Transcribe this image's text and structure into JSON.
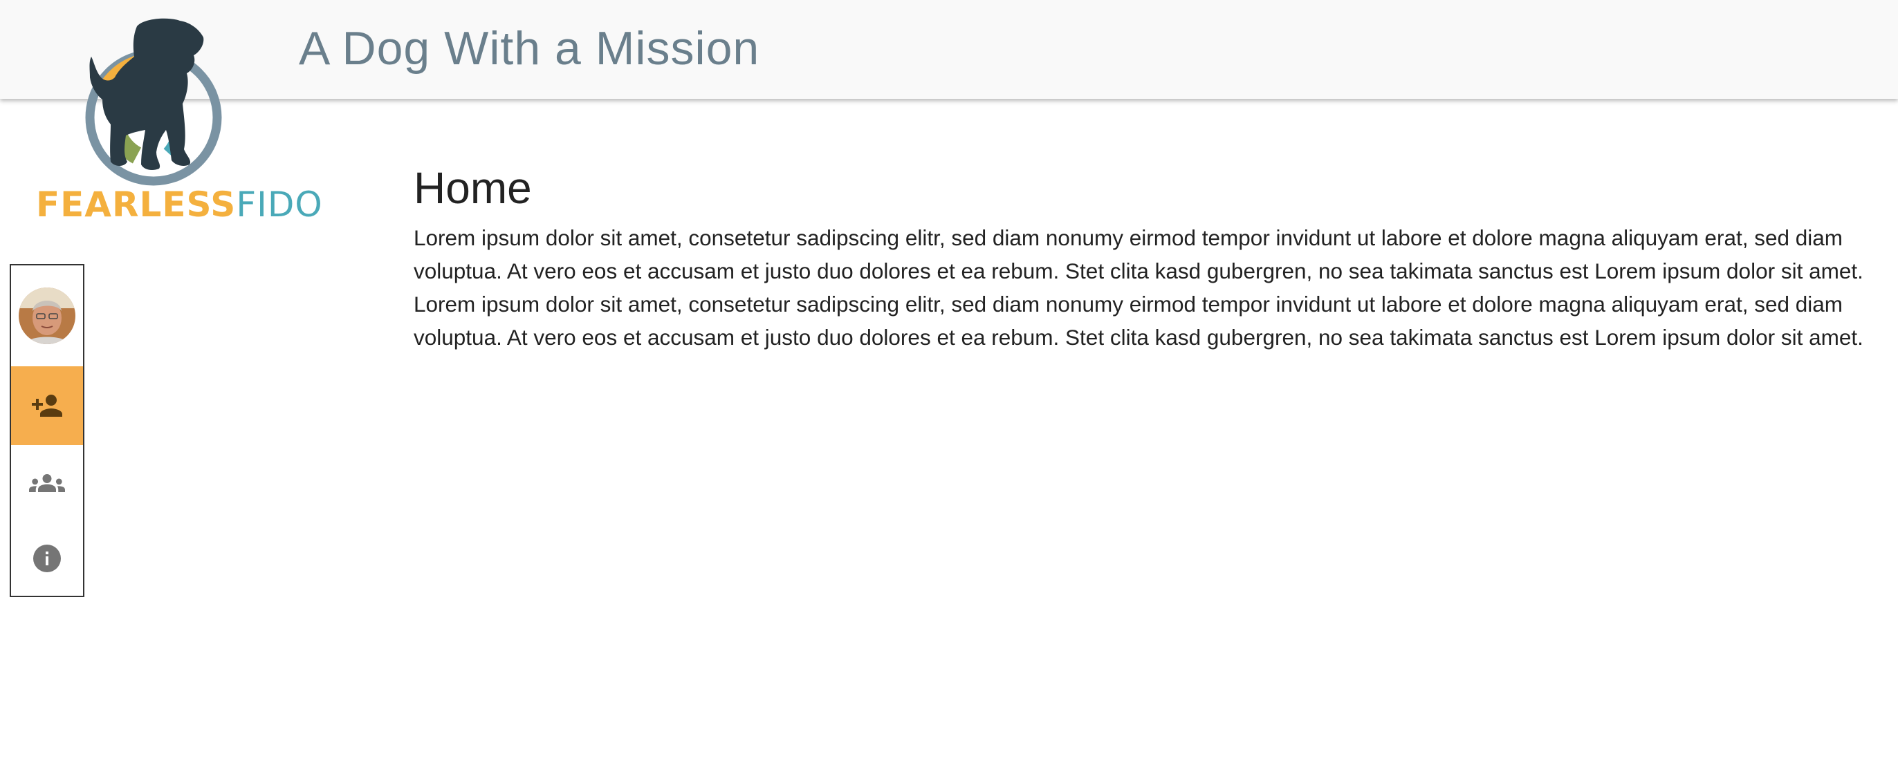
{
  "header": {
    "title": "A Dog With a Mission"
  },
  "logo": {
    "word1": "FEARLESS",
    "word2": "FIDO",
    "colors": {
      "orange": "#f4b03e",
      "teal": "#4aa9b8",
      "dog": "#2a3a44",
      "ring": "#7a93a3",
      "green": "#8aa252"
    }
  },
  "sidebar": {
    "items": [
      {
        "name": "avatar",
        "icon": "user-avatar"
      },
      {
        "name": "add-person",
        "icon": "person-add-icon",
        "active": true
      },
      {
        "name": "group",
        "icon": "group-icon"
      },
      {
        "name": "info",
        "icon": "info-icon"
      }
    ],
    "active_color": "#f6ae4e",
    "icon_color": "#757575"
  },
  "main": {
    "title": "Home",
    "body": "Lorem ipsum dolor sit amet, consetetur sadipscing elitr, sed diam nonumy eirmod tempor invidunt ut labore et dolore magna aliquyam erat, sed diam voluptua. At vero eos et accusam et justo duo dolores et ea rebum. Stet clita kasd gubergren, no sea takimata sanctus est Lorem ipsum dolor sit amet. Lorem ipsum dolor sit amet, consetetur sadipscing elitr, sed diam nonumy eirmod tempor invidunt ut labore et dolore magna aliquyam erat, sed diam voluptua. At vero eos et accusam et justo duo dolores et ea rebum. Stet clita kasd gubergren, no sea takimata sanctus est Lorem ipsum dolor sit amet."
  }
}
